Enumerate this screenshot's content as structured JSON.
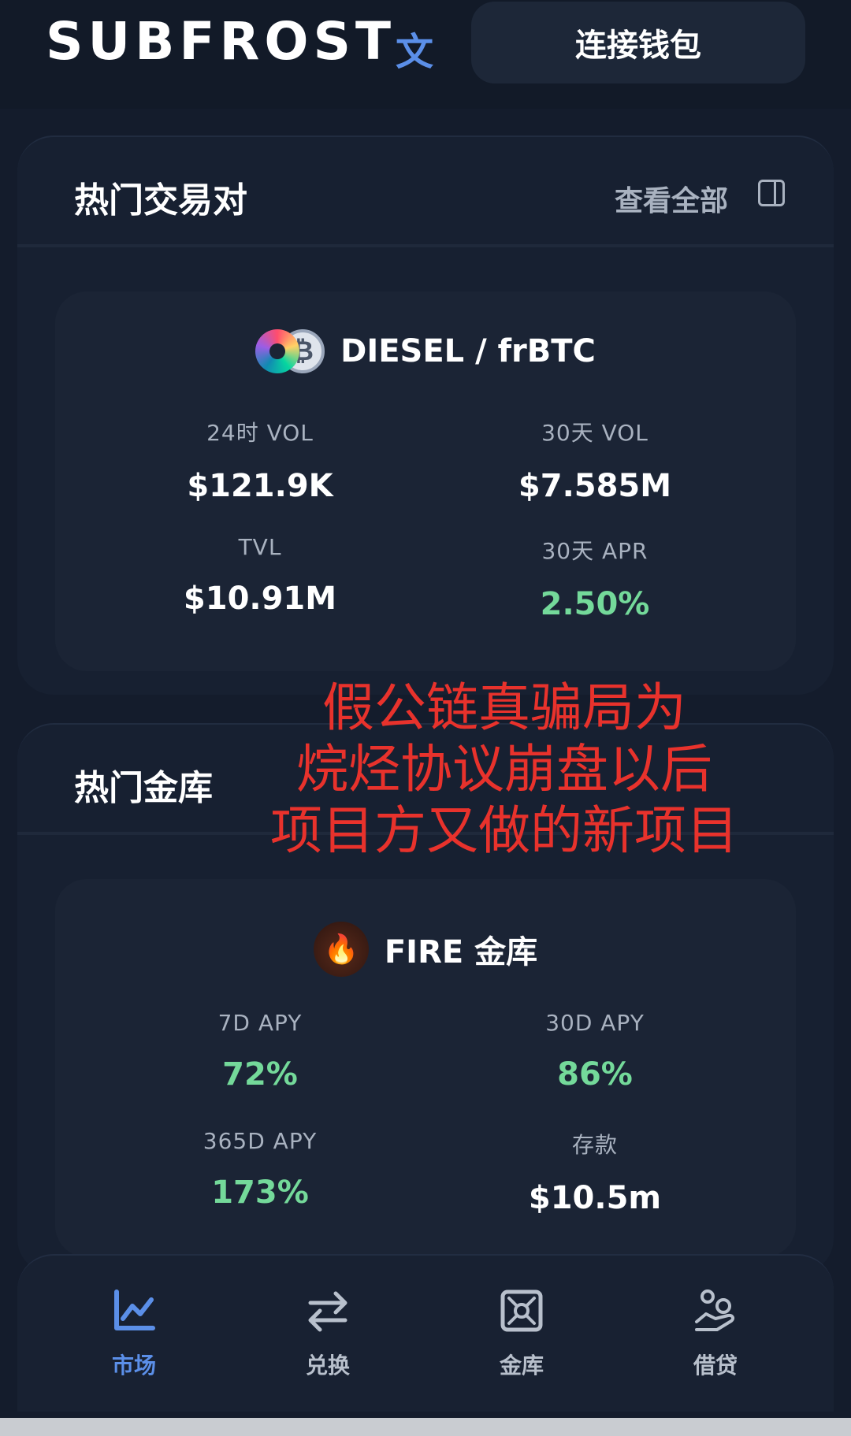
{
  "header": {
    "logo": "SUBFROST",
    "lang_icon": "文",
    "connect_wallet": "连接钱包"
  },
  "hot_pairs": {
    "title": "热门交易对",
    "view_all": "查看全部",
    "pair": {
      "name": "DIESEL / frBTC",
      "stats": [
        {
          "label": "24时 VOL",
          "value": "$121.9K"
        },
        {
          "label": "30天 VOL",
          "value": "$7.585M"
        },
        {
          "label": "TVL",
          "value": "$10.91M"
        },
        {
          "label": "30天 APR",
          "value": "2.50%"
        }
      ]
    }
  },
  "hot_vaults": {
    "title": "热门金库",
    "vault": {
      "name": "FIRE 金库",
      "stats": [
        {
          "label": "7D APY",
          "value": "72%"
        },
        {
          "label": "30D APY",
          "value": "86%"
        },
        {
          "label": "365D APY",
          "value": "173%"
        },
        {
          "label": "存款",
          "value": "$10.5m"
        }
      ]
    }
  },
  "overlay": {
    "line1": "假公链真骗局为",
    "line2": "烷烃协议崩盘以后",
    "line3": "项目方又做的新项目"
  },
  "nav": {
    "items": [
      {
        "label": "市场",
        "icon": "chart-icon"
      },
      {
        "label": "兑换",
        "icon": "swap-icon"
      },
      {
        "label": "金库",
        "icon": "vault-icon"
      },
      {
        "label": "借贷",
        "icon": "lending-icon"
      }
    ]
  },
  "colors": {
    "accent": "#5b8fe8",
    "positive": "#74d99a",
    "overlay_red": "#e8322c"
  }
}
